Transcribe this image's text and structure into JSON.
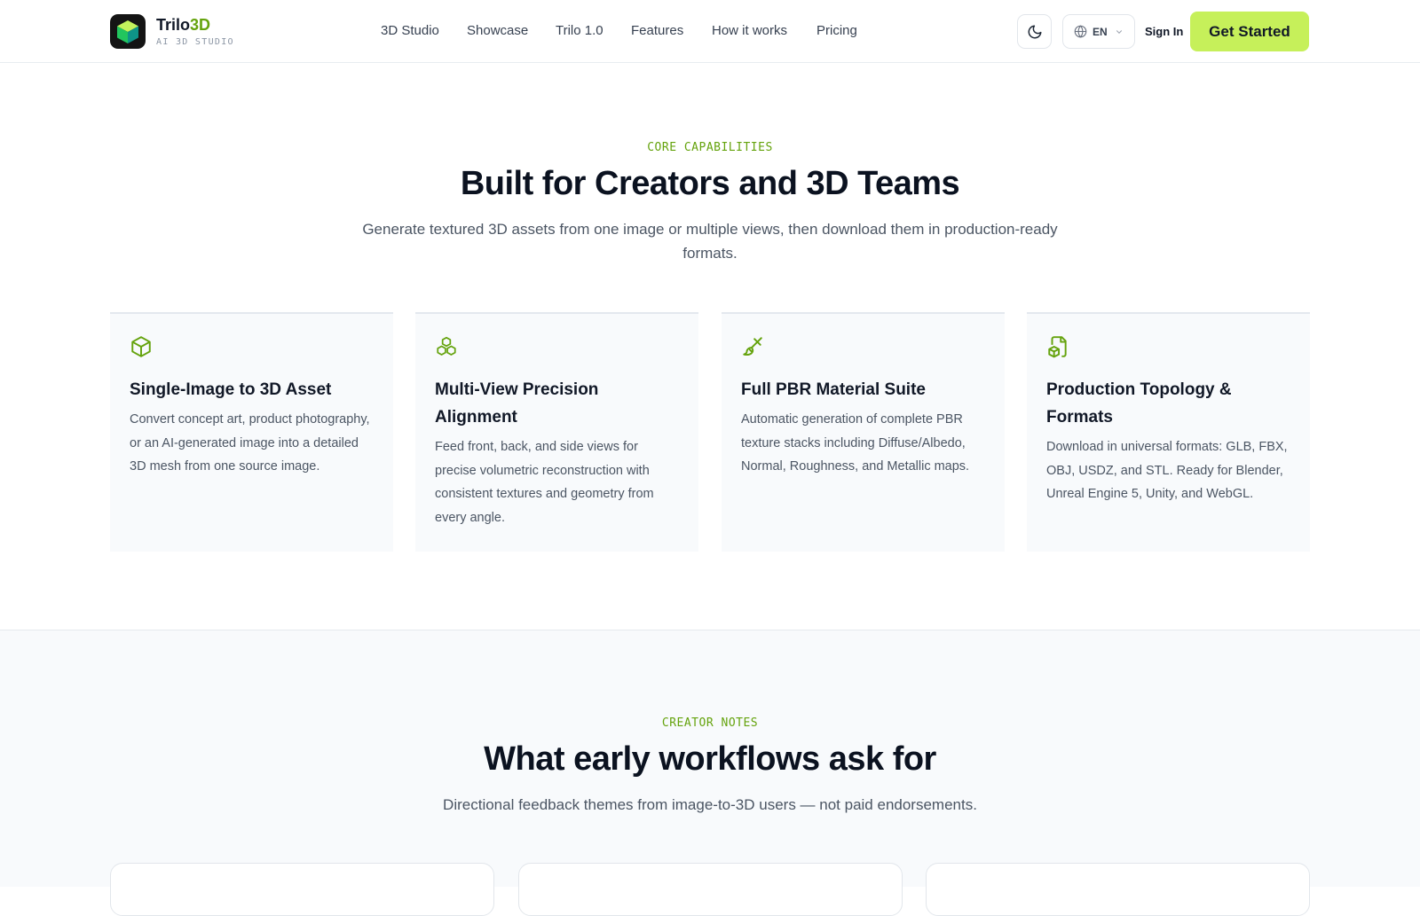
{
  "header": {
    "brand_name": "Trilo",
    "brand_accent": "3D",
    "brand_subtitle": "AI 3D STUDIO",
    "nav": [
      "3D Studio",
      "Showcase",
      "Trilo 1.0",
      "Features",
      "How it works",
      "Pricing"
    ],
    "theme_toggle_icon": "moon-icon",
    "language": "EN",
    "sign_in": "Sign In",
    "cta": "Get Started"
  },
  "capabilities": {
    "eyebrow": "CORE CAPABILITIES",
    "title": "Built for Creators and 3D Teams",
    "lead": "Generate textured 3D assets from one image or multiple views, then download them in production-ready formats.",
    "cards": [
      {
        "icon": "cube-icon",
        "title": "Single-Image to 3D Asset",
        "description": "Convert concept art, product photography, or an AI-generated image into a detailed 3D mesh from one source image."
      },
      {
        "icon": "cubes-icon",
        "title": "Multi-View Precision Alignment",
        "description": "Feed front, back, and side views for precise volumetric reconstruction with consistent textures and geometry from every angle."
      },
      {
        "icon": "paintbrush-icon",
        "title": "Full PBR Material Suite",
        "description": "Automatic generation of complete PBR texture stacks including Diffuse/Albedo, Normal, Roughness, and Metallic maps."
      },
      {
        "icon": "file-box-icon",
        "title": "Production Topology & Formats",
        "description": "Download in universal formats: GLB, FBX, OBJ, USDZ, and STL. Ready for Blender, Unreal Engine 5, Unity, and WebGL."
      }
    ]
  },
  "creator_notes": {
    "eyebrow": "CREATOR NOTES",
    "title": "What early workflows ask for",
    "lead": "Directional feedback themes from image-to-3D users — not paid endorsements."
  },
  "colors": {
    "accent": "#65a30d",
    "cta_background": "#c6f05a",
    "text_dark": "#0b1220",
    "muted": "#4b5563"
  }
}
